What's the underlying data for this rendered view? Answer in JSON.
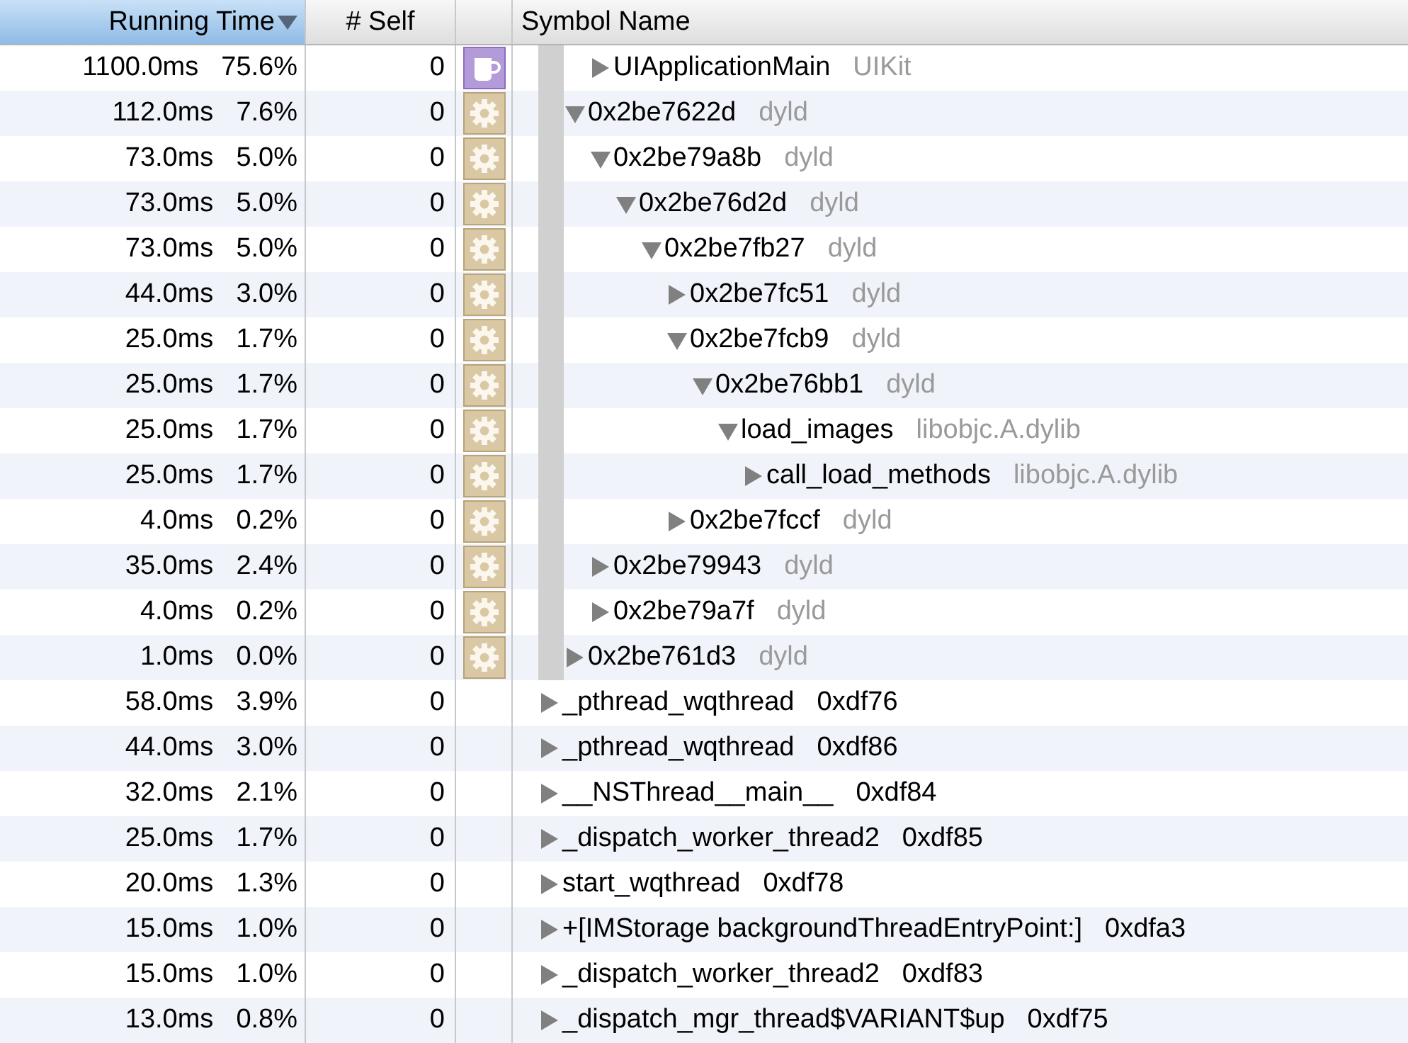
{
  "table": {
    "columns": [
      {
        "label": "Running Time",
        "selected": true,
        "sorted": true
      },
      {
        "label": "# Self",
        "selected": false
      },
      {
        "label": "Symbol Name",
        "selected": false
      }
    ],
    "rows": [
      {
        "children": [
          {
            "children": [
              {
                "time": "1100.0ms",
                "percent": "75.6%",
                "self": "0",
                "kind": "app",
                "expanded": false,
                "symbol": "UIApplicationMain",
                "library": "UIKit"
              }
            ]
          },
          {
            "time": "112.0ms",
            "percent": "7.6%",
            "self": "0",
            "kind": "library",
            "expanded": true,
            "symbol": "0x2be7622d",
            "library": "dyld",
            "children": [
              {
                "time": "73.0ms",
                "percent": "5.0%",
                "self": "0",
                "kind": "library",
                "expanded": true,
                "symbol": "0x2be79a8b",
                "library": "dyld",
                "children": [
                  {
                    "time": "73.0ms",
                    "percent": "5.0%",
                    "self": "0",
                    "kind": "library",
                    "expanded": true,
                    "symbol": "0x2be76d2d",
                    "library": "dyld",
                    "children": [
                      {
                        "time": "73.0ms",
                        "percent": "5.0%",
                        "self": "0",
                        "kind": "library",
                        "expanded": true,
                        "symbol": "0x2be7fb27",
                        "library": "dyld",
                        "children": [
                          {
                            "time": "44.0ms",
                            "percent": "3.0%",
                            "self": "0",
                            "kind": "library",
                            "expanded": false,
                            "symbol": "0x2be7fc51",
                            "library": "dyld"
                          },
                          {
                            "time": "25.0ms",
                            "percent": "1.7%",
                            "self": "0",
                            "kind": "library",
                            "expanded": true,
                            "symbol": "0x2be7fcb9",
                            "library": "dyld",
                            "children": [
                              {
                                "time": "25.0ms",
                                "percent": "1.7%",
                                "self": "0",
                                "kind": "library",
                                "expanded": true,
                                "symbol": "0x2be76bb1",
                                "library": "dyld",
                                "children": [
                                  {
                                    "time": "25.0ms",
                                    "percent": "1.7%",
                                    "self": "0",
                                    "kind": "library",
                                    "expanded": true,
                                    "symbol": "load_images",
                                    "library": "libobjc.A.dylib",
                                    "children": [
                                      {
                                        "time": "25.0ms",
                                        "percent": "1.7%",
                                        "self": "0",
                                        "kind": "library",
                                        "expanded": false,
                                        "symbol": "call_load_methods",
                                        "library": "libobjc.A.dylib"
                                      }
                                    ]
                                  }
                                ]
                              }
                            ]
                          },
                          {
                            "time": "4.0ms",
                            "percent": "0.2%",
                            "self": "0",
                            "kind": "library",
                            "expanded": false,
                            "symbol": "0x2be7fccf",
                            "library": "dyld"
                          }
                        ]
                      }
                    ]
                  }
                ]
              },
              {
                "time": "35.0ms",
                "percent": "2.4%",
                "self": "0",
                "kind": "library",
                "expanded": false,
                "symbol": "0x2be79943",
                "library": "dyld"
              },
              {
                "time": "4.0ms",
                "percent": "0.2%",
                "self": "0",
                "kind": "library",
                "expanded": false,
                "symbol": "0x2be79a7f",
                "library": "dyld"
              }
            ]
          },
          {
            "time": "1.0ms",
            "percent": "0.0%",
            "self": "0",
            "kind": "library",
            "expanded": false,
            "symbol": "0x2be761d3",
            "library": "dyld"
          }
        ]
      },
      {
        "time": "58.0ms",
        "percent": "3.9%",
        "self": "0",
        "expanded": false,
        "symbol": "_pthread_wqthread",
        "library": "0xdf76"
      },
      {
        "time": "44.0ms",
        "percent": "3.0%",
        "self": "0",
        "expanded": false,
        "symbol": "_pthread_wqthread",
        "library": "0xdf86"
      },
      {
        "time": "32.0ms",
        "percent": "2.1%",
        "self": "0",
        "expanded": false,
        "symbol": "__NSThread__main__",
        "library": "0xdf84"
      },
      {
        "time": "25.0ms",
        "percent": "1.7%",
        "self": "0",
        "expanded": false,
        "symbol": "_dispatch_worker_thread2",
        "library": "0xdf85"
      },
      {
        "time": "20.0ms",
        "percent": "1.3%",
        "self": "0",
        "expanded": false,
        "symbol": "start_wqthread",
        "library": "0xdf78"
      },
      {
        "time": "15.0ms",
        "percent": "1.0%",
        "self": "0",
        "expanded": false,
        "symbol": "+[IMStorage backgroundThreadEntryPoint:]",
        "library": "0xdfa3"
      },
      {
        "time": "15.0ms",
        "percent": "1.0%",
        "self": "0",
        "expanded": false,
        "symbol": "_dispatch_worker_thread2",
        "library": "0xdf83"
      },
      {
        "time": "13.0ms",
        "percent": "0.8%",
        "self": "0",
        "expanded": false,
        "symbol": "_dispatch_mgr_thread$VARIANT$up",
        "library": "0xdf75"
      }
    ]
  }
}
